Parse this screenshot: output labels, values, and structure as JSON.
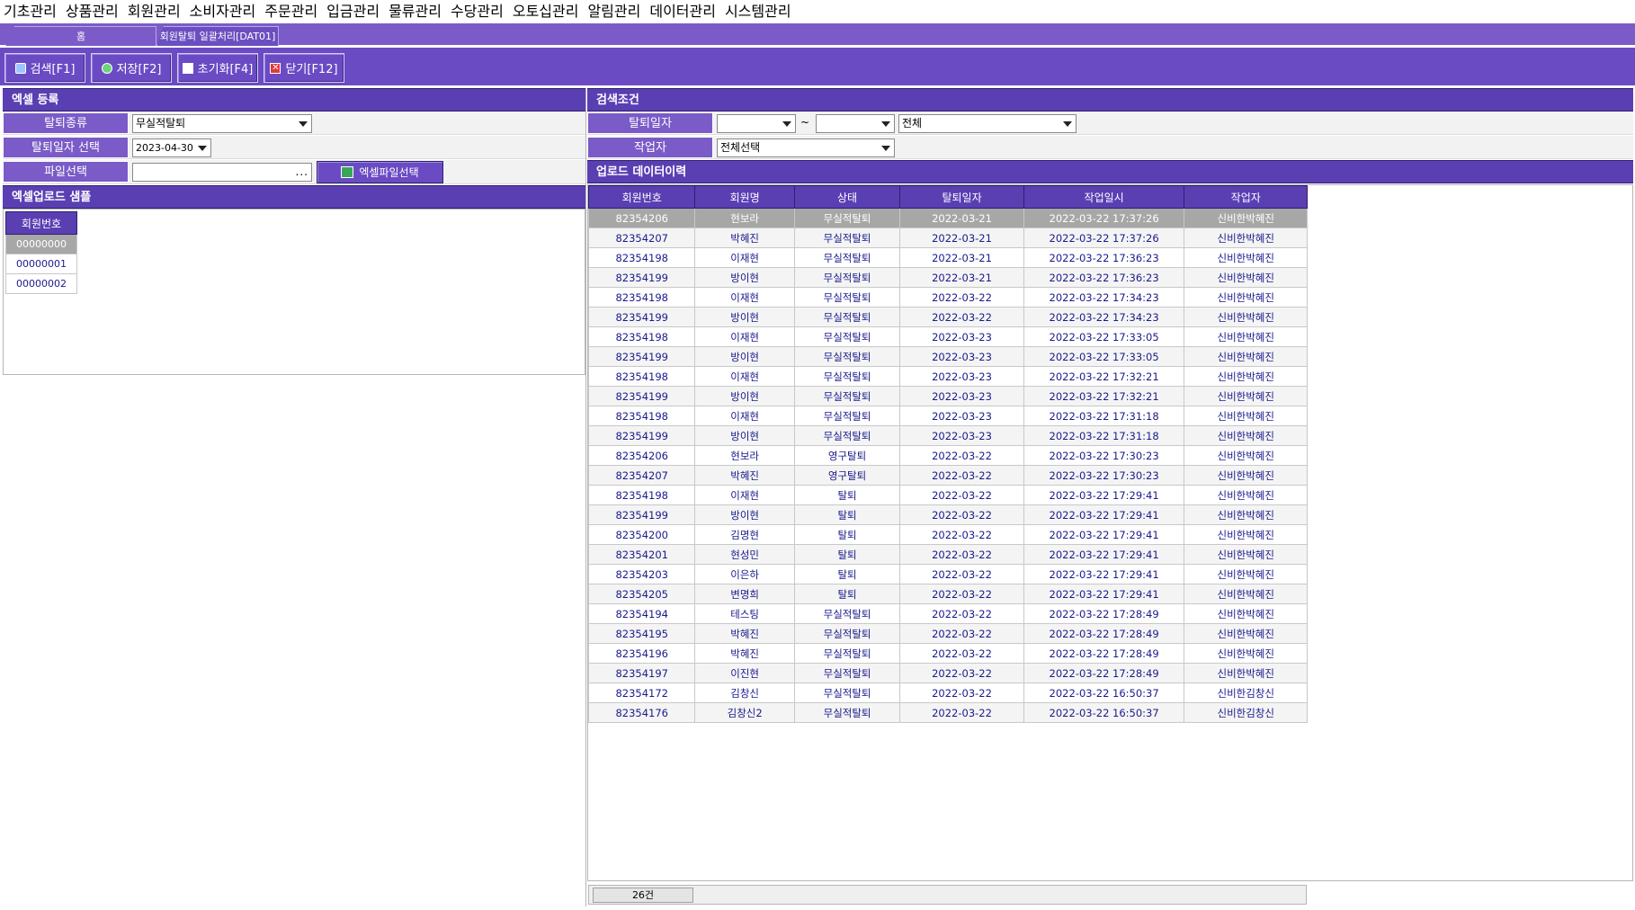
{
  "menu": [
    "기초관리",
    "상품관리",
    "회원관리",
    "소비자관리",
    "주문관리",
    "입금관리",
    "물류관리",
    "수당관리",
    "오토십관리",
    "알림관리",
    "데이터관리",
    "시스템관리"
  ],
  "tabs": {
    "home": "홈",
    "active": "회원탈퇴 일괄처리[DAT01]"
  },
  "toolbar": {
    "search": "검색[F1]",
    "save": "저장[F2]",
    "reset": "초기화[F4]",
    "close": "닫기[F12]"
  },
  "excel": {
    "header": "엑셀 등록",
    "type_label": "탈퇴종류",
    "type_value": "무실적탈퇴",
    "date_label": "탈퇴일자 선택",
    "date_value": "2023-04-30",
    "file_label": "파일선택",
    "file_value": "",
    "file_dots": "...",
    "excel_button": "엑셀파일선택"
  },
  "sample": {
    "header": "엑셀업로드 샘플",
    "column": "회원번호",
    "rows": [
      "00000000",
      "00000001",
      "00000002"
    ]
  },
  "search": {
    "header": "검색조건",
    "date_label": "탈퇴일자",
    "date_from": "",
    "tilde": "~",
    "date_to": "",
    "scope_value": "전체",
    "worker_label": "작업자",
    "worker_value": "전체선택"
  },
  "history": {
    "header": "업로드 데이터이력",
    "columns": [
      "회원번호",
      "회원명",
      "상태",
      "탈퇴일자",
      "작업일시",
      "작업자"
    ],
    "rows": [
      [
        "82354206",
        "현보라",
        "무실적탈퇴",
        "2022-03-21",
        "2022-03-22 17:37:26",
        "신비한박혜진"
      ],
      [
        "82354207",
        "박혜진",
        "무실적탈퇴",
        "2022-03-21",
        "2022-03-22 17:37:26",
        "신비한박혜진"
      ],
      [
        "82354198",
        "이재현",
        "무실적탈퇴",
        "2022-03-21",
        "2022-03-22 17:36:23",
        "신비한박혜진"
      ],
      [
        "82354199",
        "방이현",
        "무실적탈퇴",
        "2022-03-21",
        "2022-03-22 17:36:23",
        "신비한박혜진"
      ],
      [
        "82354198",
        "이재현",
        "무실적탈퇴",
        "2022-03-22",
        "2022-03-22 17:34:23",
        "신비한박혜진"
      ],
      [
        "82354199",
        "방이현",
        "무실적탈퇴",
        "2022-03-22",
        "2022-03-22 17:34:23",
        "신비한박혜진"
      ],
      [
        "82354198",
        "이재현",
        "무실적탈퇴",
        "2022-03-23",
        "2022-03-22 17:33:05",
        "신비한박혜진"
      ],
      [
        "82354199",
        "방이현",
        "무실적탈퇴",
        "2022-03-23",
        "2022-03-22 17:33:05",
        "신비한박혜진"
      ],
      [
        "82354198",
        "이재현",
        "무실적탈퇴",
        "2022-03-23",
        "2022-03-22 17:32:21",
        "신비한박혜진"
      ],
      [
        "82354199",
        "방이현",
        "무실적탈퇴",
        "2022-03-23",
        "2022-03-22 17:32:21",
        "신비한박혜진"
      ],
      [
        "82354198",
        "이재현",
        "무실적탈퇴",
        "2022-03-23",
        "2022-03-22 17:31:18",
        "신비한박혜진"
      ],
      [
        "82354199",
        "방이현",
        "무실적탈퇴",
        "2022-03-23",
        "2022-03-22 17:31:18",
        "신비한박혜진"
      ],
      [
        "82354206",
        "현보라",
        "영구탈퇴",
        "2022-03-22",
        "2022-03-22 17:30:23",
        "신비한박혜진"
      ],
      [
        "82354207",
        "박혜진",
        "영구탈퇴",
        "2022-03-22",
        "2022-03-22 17:30:23",
        "신비한박혜진"
      ],
      [
        "82354198",
        "이재현",
        "탈퇴",
        "2022-03-22",
        "2022-03-22 17:29:41",
        "신비한박혜진"
      ],
      [
        "82354199",
        "방이현",
        "탈퇴",
        "2022-03-22",
        "2022-03-22 17:29:41",
        "신비한박혜진"
      ],
      [
        "82354200",
        "김명현",
        "탈퇴",
        "2022-03-22",
        "2022-03-22 17:29:41",
        "신비한박혜진"
      ],
      [
        "82354201",
        "현성민",
        "탈퇴",
        "2022-03-22",
        "2022-03-22 17:29:41",
        "신비한박혜진"
      ],
      [
        "82354203",
        "이은하",
        "탈퇴",
        "2022-03-22",
        "2022-03-22 17:29:41",
        "신비한박혜진"
      ],
      [
        "82354205",
        "변명희",
        "탈퇴",
        "2022-03-22",
        "2022-03-22 17:29:41",
        "신비한박혜진"
      ],
      [
        "82354194",
        "테스팅",
        "무실적탈퇴",
        "2022-03-22",
        "2022-03-22 17:28:49",
        "신비한박혜진"
      ],
      [
        "82354195",
        "박혜진",
        "무실적탈퇴",
        "2022-03-22",
        "2022-03-22 17:28:49",
        "신비한박혜진"
      ],
      [
        "82354196",
        "박혜진",
        "무실적탈퇴",
        "2022-03-22",
        "2022-03-22 17:28:49",
        "신비한박혜진"
      ],
      [
        "82354197",
        "이진현",
        "무실적탈퇴",
        "2022-03-22",
        "2022-03-22 17:28:49",
        "신비한박혜진"
      ],
      [
        "82354172",
        "김창신",
        "무실적탈퇴",
        "2022-03-22",
        "2022-03-22 16:50:37",
        "신비한김창신"
      ],
      [
        "82354176",
        "김창신2",
        "무실적탈퇴",
        "2022-03-22",
        "2022-03-22 16:50:37",
        "신비한김창신"
      ]
    ],
    "count_text": "26건"
  }
}
